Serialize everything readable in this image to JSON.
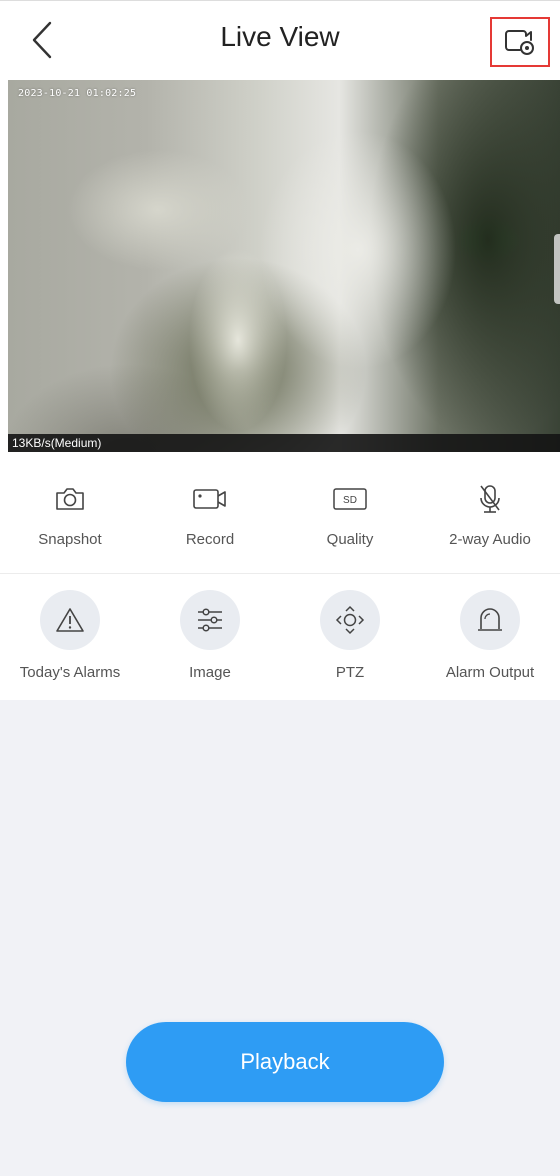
{
  "header": {
    "title": "Live View",
    "back_icon": "chevron-left-icon",
    "settings_icon": "camera-settings-icon"
  },
  "video": {
    "timestamp": "2023-10-21 01:02:25",
    "bitrate": "13KB/s(Medium)"
  },
  "controls": [
    {
      "label": "Snapshot",
      "icon": "camera-icon"
    },
    {
      "label": "Record",
      "icon": "video-record-icon"
    },
    {
      "label": "Quality",
      "icon": "sd-quality-icon"
    },
    {
      "label": "2-way Audio",
      "icon": "microphone-off-icon"
    }
  ],
  "functions": [
    {
      "label": "Today's Alarms",
      "icon": "warning-icon"
    },
    {
      "label": "Image",
      "icon": "sliders-icon"
    },
    {
      "label": "PTZ",
      "icon": "ptz-direction-icon"
    },
    {
      "label": "Alarm Output",
      "icon": "alarm-siren-icon"
    }
  ],
  "playback": {
    "label": "Playback"
  },
  "colors": {
    "accent": "#2e9cf4",
    "highlight_border": "#e53935",
    "background": "#f1f2f6"
  }
}
